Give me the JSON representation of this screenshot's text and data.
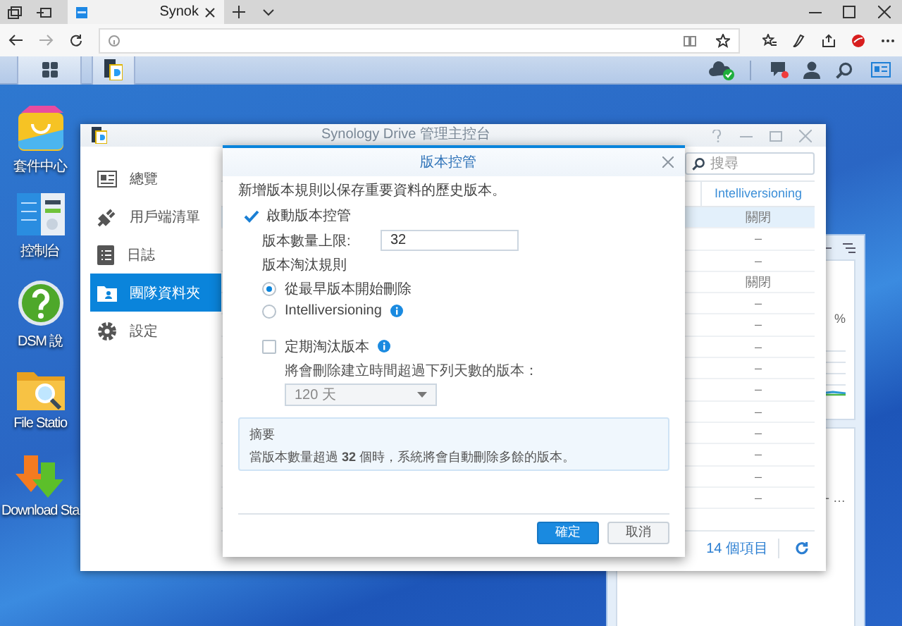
{
  "browser": {
    "tabs": [
      {
        "label": "Synok",
        "selected": true
      }
    ]
  },
  "desktop_icons": [
    {
      "label": "套件中心",
      "kind": "package"
    },
    {
      "label": "控制台",
      "kind": "control"
    },
    {
      "label": "DSM 說",
      "kind": "help"
    },
    {
      "label": "File Statio",
      "kind": "folder"
    },
    {
      "label": "Download Sta",
      "kind": "download"
    }
  ],
  "widget_window": {
    "text_1": "%",
    "text_2": "- …"
  },
  "drive_window": {
    "title": "Synology Drive 管理主控台",
    "sidebar": [
      {
        "label": "總覽",
        "kind": "overview",
        "selected": false
      },
      {
        "label": "用戶端清單",
        "kind": "clients",
        "selected": false
      },
      {
        "label": "日誌",
        "kind": "log",
        "selected": false
      },
      {
        "label": "團隊資料夾",
        "kind": "team",
        "selected": true
      },
      {
        "label": "設定",
        "kind": "settings",
        "selected": false
      }
    ],
    "search": {
      "placeholder": "搜尋"
    },
    "table": {
      "columns": [
        "Intelliversioning"
      ],
      "rows": [
        {
          "cells": [
            "關閉"
          ],
          "selected": true
        },
        {
          "cells": [
            "–"
          ],
          "selected": false
        },
        {
          "cells": [
            "–"
          ],
          "selected": false
        },
        {
          "cells": [
            "關閉"
          ],
          "selected": false
        },
        {
          "cells": [
            "–"
          ],
          "selected": false
        },
        {
          "cells": [
            "–"
          ],
          "selected": false
        },
        {
          "cells": [
            "–"
          ],
          "selected": false
        },
        {
          "cells": [
            "–"
          ],
          "selected": false
        },
        {
          "cells": [
            "–"
          ],
          "selected": false
        },
        {
          "cells": [
            "–"
          ],
          "selected": false
        },
        {
          "cells": [
            "–"
          ],
          "selected": false
        },
        {
          "cells": [
            "–"
          ],
          "selected": false
        },
        {
          "cells": [
            "–"
          ],
          "selected": false
        },
        {
          "cells": [
            "–"
          ],
          "selected": false
        }
      ]
    },
    "item_count": "14 個項目"
  },
  "dialog": {
    "title": "版本控管",
    "intro": "新增版本規則以保存重要資料的歷史版本。",
    "enable": {
      "label": "啟動版本控管",
      "checked": true
    },
    "limit": {
      "label": "版本數量上限:",
      "value": "32"
    },
    "rule_heading": "版本淘汰規則",
    "rules": [
      {
        "label": "從最早版本開始刪除",
        "selected": true,
        "info": false
      },
      {
        "label": "Intelliversioning",
        "selected": false,
        "info": true
      }
    ],
    "periodic": {
      "label": "定期淘汰版本",
      "checked": false,
      "info": true
    },
    "days_label": "將會刪除建立時間超過下列天數的版本：",
    "days": {
      "value": "120 天",
      "disabled": true
    },
    "summary": {
      "heading": "摘要",
      "text": "當版本數量超過 **32** 個時，系統將會自動刪除多餘的版本。"
    },
    "buttons": [
      {
        "label": "確定",
        "kind": "primary"
      },
      {
        "label": "取消",
        "kind": "secondary"
      }
    ]
  }
}
